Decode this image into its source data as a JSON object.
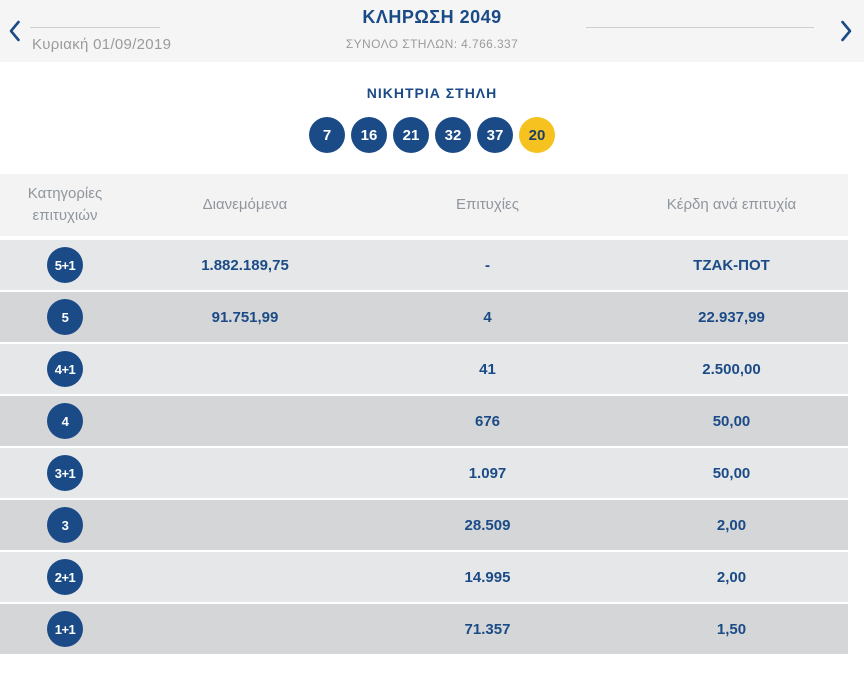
{
  "colors": {
    "brand_blue": "#1b4b87",
    "bonus_yellow": "#f6c21f",
    "band_bg": "#f5f5f6",
    "table_header_bg": "#f3f3f4",
    "row_light": "#e6e7e8",
    "row_dark": "#d5d6d8",
    "muted_gray": "#9b9b9b"
  },
  "header": {
    "prev_icon": "chevron-left-icon",
    "next_icon": "chevron-right-icon",
    "date": "Κυριακή 01/09/2019",
    "title": "ΚΛΗΡΩΣΗ 2049",
    "total_columns": "ΣΥΝΟΛΟ ΣΤΗΛΩΝ: 4.766.337"
  },
  "winning_column": {
    "title": "ΝΙΚΗΤΡΙΑ ΣΤΗΛΗ",
    "numbers": [
      "7",
      "16",
      "21",
      "32",
      "37"
    ],
    "bonus": "20"
  },
  "results_table": {
    "headers": {
      "category": "Κατηγορίες επιτυχιών",
      "distributed": "Διανεμόμενα",
      "winners": "Επιτυχίες",
      "prize": "Κέρδη ανά επιτυχία"
    },
    "rows": [
      {
        "category": "5+1",
        "distributed": "1.882.189,75",
        "winners": "-",
        "prize": "ΤΖΑΚ-ΠΟΤ"
      },
      {
        "category": "5",
        "distributed": "91.751,99",
        "winners": "4",
        "prize": "22.937,99"
      },
      {
        "category": "4+1",
        "distributed": "",
        "winners": "41",
        "prize": "2.500,00"
      },
      {
        "category": "4",
        "distributed": "",
        "winners": "676",
        "prize": "50,00"
      },
      {
        "category": "3+1",
        "distributed": "",
        "winners": "1.097",
        "prize": "50,00"
      },
      {
        "category": "3",
        "distributed": "",
        "winners": "28.509",
        "prize": "2,00"
      },
      {
        "category": "2+1",
        "distributed": "",
        "winners": "14.995",
        "prize": "2,00"
      },
      {
        "category": "1+1",
        "distributed": "",
        "winners": "71.357",
        "prize": "1,50"
      }
    ]
  }
}
